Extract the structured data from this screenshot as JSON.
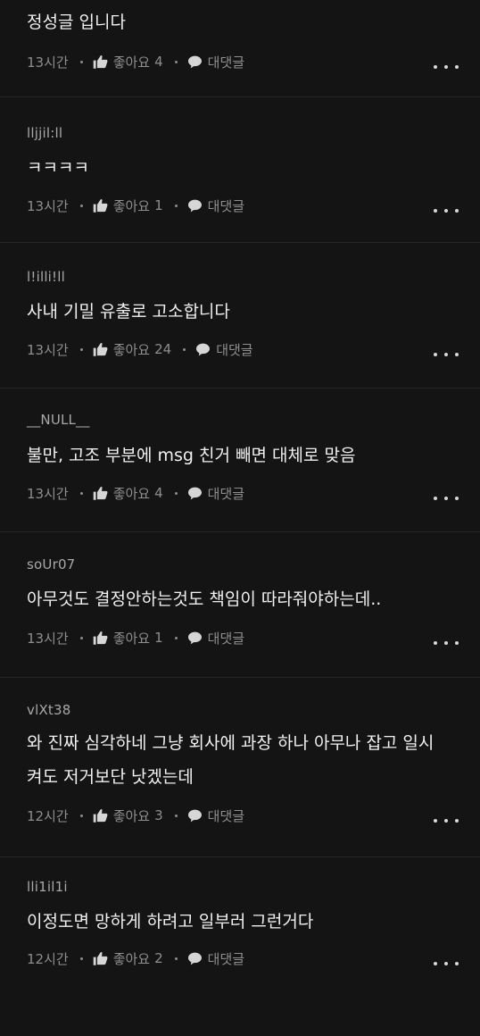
{
  "labels": {
    "like": "좋아요",
    "reply": "대댓글"
  },
  "comments": [
    {
      "author": "",
      "body": "정성글 입니다",
      "time": "13시간",
      "likes": "4"
    },
    {
      "author": "lljjil:ll",
      "body": "ㅋㅋㅋㅋ",
      "time": "13시간",
      "likes": "1"
    },
    {
      "author": "l!illi!ll",
      "body": "사내 기밀 유출로 고소합니다",
      "time": "13시간",
      "likes": "24"
    },
    {
      "author": "__NULL__",
      "body": "불만, 고조 부분에 msg 친거 빼면 대체로 맞음",
      "time": "13시간",
      "likes": "4"
    },
    {
      "author": "soUr07",
      "body": "아무것도 결정안하는것도 책임이 따라줘야하는데..",
      "time": "13시간",
      "likes": "1"
    },
    {
      "author": "vlXt38",
      "body": "와 진짜 심각하네 그냥 회사에 과장 하나 아무나 잡고 일시켜도 저거보단 낫겠는데",
      "time": "12시간",
      "likes": "3"
    },
    {
      "author": "lli1il1i",
      "body": "이정도면 망하게 하려고 일부러 그런거다",
      "time": "12시간",
      "likes": "2"
    }
  ],
  "colors": {
    "background": "#141414",
    "divider": "#262626",
    "text": "#f0f0f0",
    "muted": "#8e8e8e"
  },
  "icons": {
    "like": "thumbs-up-icon",
    "reply": "speech-bubble-icon",
    "more": "more-dots-icon"
  }
}
